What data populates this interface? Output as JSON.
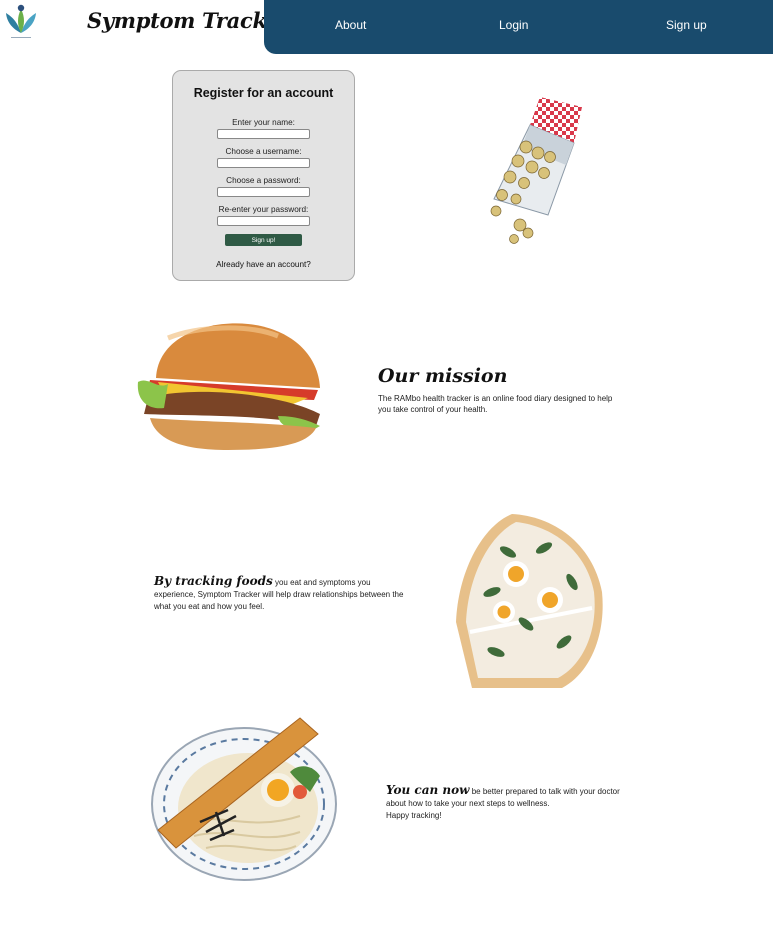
{
  "header": {
    "brand": "Symptom Tracker",
    "nav": {
      "about": "About",
      "login": "Login",
      "signup": "Sign up"
    }
  },
  "register": {
    "title": "Register for an account",
    "name_label": "Enter your name:",
    "username_label": "Choose a username:",
    "password_label": "Choose a password:",
    "reenter_label": "Re-enter your password:",
    "submit": "Sign up!",
    "have_account": "Already have an account?"
  },
  "mission": {
    "title": "Our mission",
    "text": "The RAMbo health tracker is an online food diary designed to help you take control of your health."
  },
  "tracking": {
    "lead": "By tracking foods",
    "text": " you eat and symptoms you experience, Symptom Tracker will help draw relationships between the what you eat and how you feel."
  },
  "cannow": {
    "lead": "You can now",
    "text": " be better prepared to talk with your doctor about how to take your next steps to wellness.",
    "closing": "Happy tracking!"
  },
  "colors": {
    "navbar": "#194b6d",
    "button": "#2f5a45",
    "card": "#e3e3e3"
  }
}
